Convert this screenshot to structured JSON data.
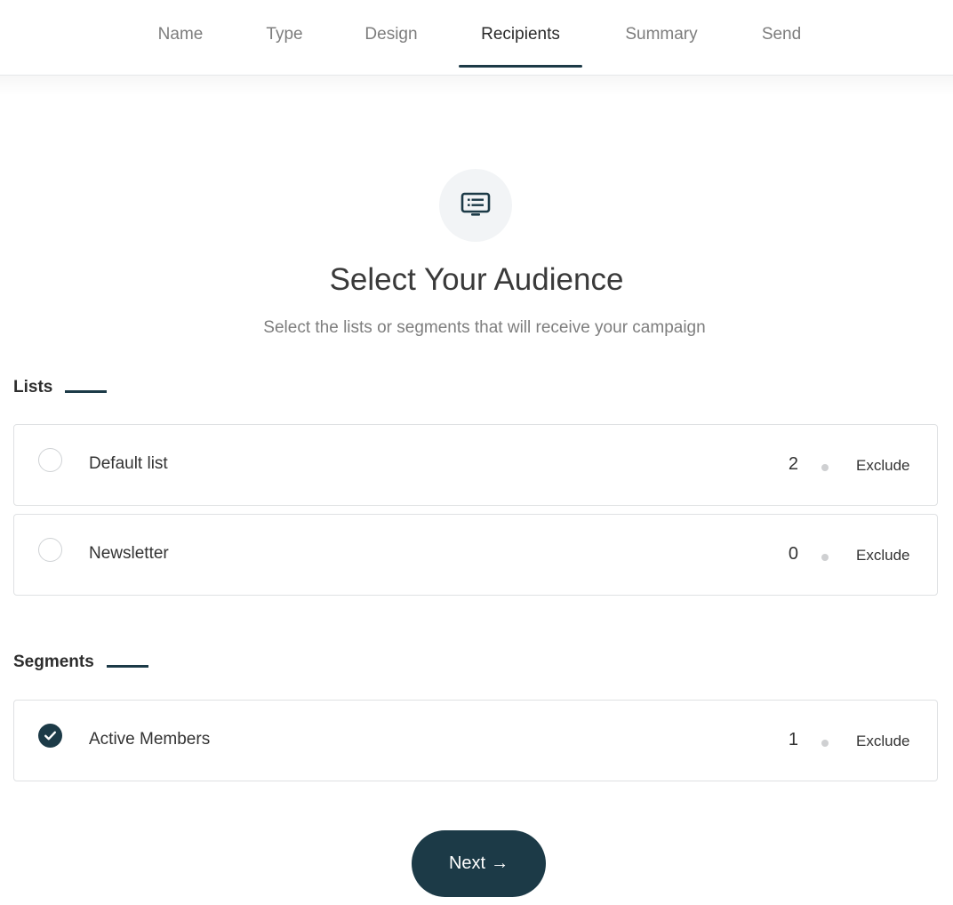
{
  "tabs": [
    {
      "label": "Name",
      "active": false
    },
    {
      "label": "Type",
      "active": false
    },
    {
      "label": "Design",
      "active": false
    },
    {
      "label": "Recipients",
      "active": true
    },
    {
      "label": "Summary",
      "active": false
    },
    {
      "label": "Send",
      "active": false
    }
  ],
  "hero": {
    "icon": "list-screen-icon",
    "title": "Select Your Audience",
    "subtitle": "Select the lists or segments that will receive your campaign"
  },
  "lists": {
    "heading": "Lists",
    "items": [
      {
        "label": "Default list",
        "count": "2",
        "exclude_label": "Exclude",
        "selected": false
      },
      {
        "label": "Newsletter",
        "count": "0",
        "exclude_label": "Exclude",
        "selected": false
      }
    ]
  },
  "segments": {
    "heading": "Segments",
    "items": [
      {
        "label": "Active Members",
        "count": "1",
        "exclude_label": "Exclude",
        "selected": true
      }
    ]
  },
  "footer": {
    "next_label": "Next",
    "next_arrow": "→"
  },
  "colors": {
    "accent": "#1c3a47",
    "border": "#dfe1e3",
    "muted_text": "#7e7e7e"
  }
}
